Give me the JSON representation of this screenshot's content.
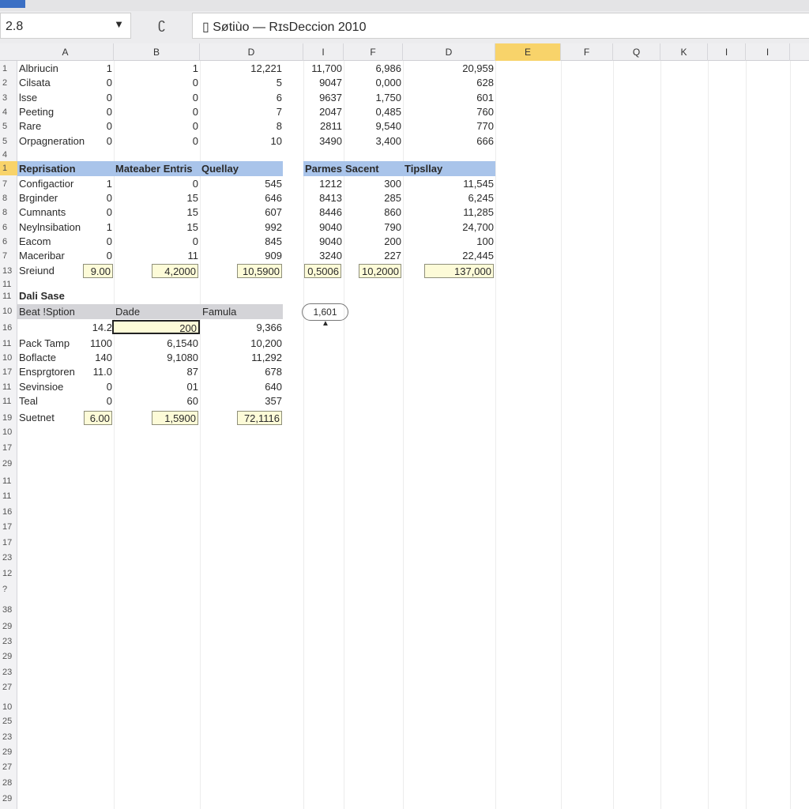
{
  "toolbar": {
    "name_box": "2.8",
    "fx_icon": "function-icon",
    "formula": "Søtiùo — RɪsDeccion 2010"
  },
  "columns": [
    "A",
    "B",
    "D",
    "I",
    "F",
    "D",
    "E",
    "F",
    "Q",
    "K",
    "I",
    "I"
  ],
  "selected_column": "E",
  "accent": "#f8d36a",
  "header_blue": "#a9c4ea",
  "total_fill": "#fdfbd8",
  "row_numbers": [
    "1",
    "2",
    "3",
    "4",
    "5",
    "5",
    "4",
    "1",
    "7",
    "8",
    "8",
    "6",
    "6",
    "7",
    "13",
    "11",
    "11",
    "10",
    "16",
    "11",
    "10",
    "17",
    "11",
    "11",
    "19",
    "10",
    "17",
    "29",
    "11",
    "11",
    "16",
    "17",
    "17",
    "23",
    "12",
    "?",
    "38",
    "29",
    "23",
    "29",
    "23",
    "27",
    "10",
    "25",
    "23",
    "29",
    "27",
    "28",
    "29"
  ],
  "section1": {
    "rows": [
      [
        "Albriucin",
        "1",
        "1",
        "12,221",
        "11,700",
        "6,986",
        "20,959"
      ],
      [
        "Cilsata",
        "0",
        "0",
        "5",
        "9047",
        "0,000",
        "628"
      ],
      [
        "lsse",
        "0",
        "0",
        "6",
        "9637",
        "1,750",
        "601"
      ],
      [
        "Peeting",
        "0",
        "0",
        "7",
        "2047",
        "0,485",
        "760"
      ],
      [
        "Rare",
        "0",
        "0",
        "8",
        "2811",
        "9,540",
        "770"
      ],
      [
        "Orpagneration",
        "0",
        "0",
        "10",
        "3490",
        "3,400",
        "666"
      ]
    ]
  },
  "section2": {
    "headers": [
      "Reprisation",
      "Mateaber Entris",
      "Quellay",
      "Parmes",
      "Sacent",
      "Tipsllay"
    ],
    "rows": [
      [
        "Configactior",
        "1",
        "0",
        "545",
        "1212",
        "300",
        "11,545"
      ],
      [
        "Brginder",
        "0",
        "15",
        "646",
        "8413",
        "285",
        "6,245"
      ],
      [
        "Cumnants",
        "0",
        "15",
        "607",
        "8446",
        "860",
        "11,285"
      ],
      [
        "Neylnsibation",
        "1",
        "15",
        "992",
        "9040",
        "790",
        "24,700"
      ],
      [
        "Eacom",
        "0",
        "0",
        "845",
        "9040",
        "200",
        "100"
      ],
      [
        "Maceribar",
        "0",
        "11",
        "909",
        "3240",
        "227",
        "22,445"
      ]
    ],
    "total": [
      "Sreiund",
      "9.00",
      "4,2000",
      "10,5900",
      "0,5006",
      "10,2000",
      "137,000"
    ]
  },
  "section3": {
    "title": "Dali Sase",
    "headers": [
      "Beat !Sption",
      "Dade",
      "Famula"
    ],
    "first_row": [
      "",
      "14.2",
      "200",
      "9,366"
    ],
    "rows": [
      [
        "Pack Tamp",
        "1100",
        "6,1540",
        "10,200"
      ],
      [
        "Boflacte",
        "140",
        "9,1080",
        "11,292"
      ],
      [
        "Ensprgtoren",
        "11.0",
        "87",
        "678"
      ],
      [
        "Sevinsioe",
        "0",
        "01",
        "640"
      ],
      [
        "Teal",
        "0",
        "60",
        "357"
      ]
    ],
    "total": [
      "Suetnet",
      "6.00",
      "1,5900",
      "72,1116"
    ]
  },
  "callout": {
    "value": "1,601",
    "cursor_icon": "pointer-cursor-icon"
  }
}
